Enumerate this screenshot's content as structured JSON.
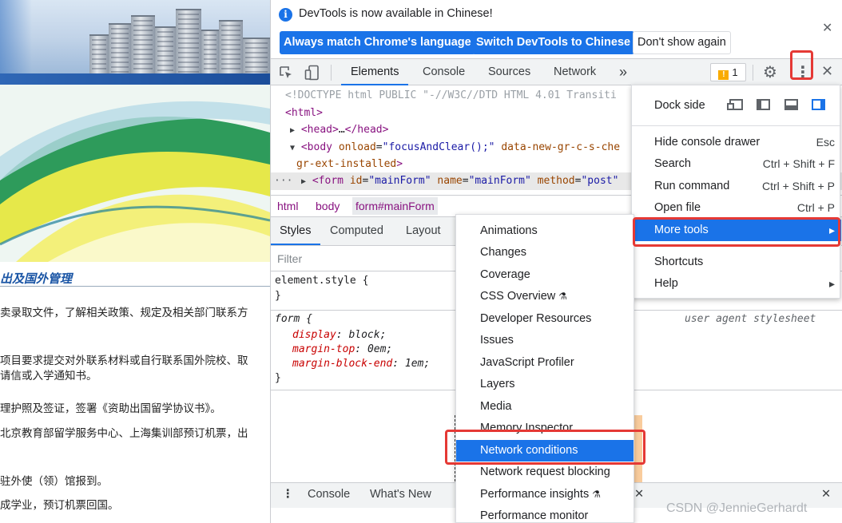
{
  "webpage": {
    "section_title": "出及国外管理",
    "paragraphs": [
      "卖录取文件，了解相关政策、规定及相关部门联系方",
      "项目要求提交对外联系材料或自行联系国外院校、取",
      "请信或入学通知书。",
      "理护照及签证，签署《资助出国留学协议书》。",
      "北京教育部留学服务中心、上海集训部预订机票，出",
      "驻外使（领）馆报到。",
      "成学业，预订机票回国。"
    ]
  },
  "infobar": {
    "message": "DevTools is now available in Chinese!",
    "info_icon": "info-icon",
    "buttons": {
      "match": "Always match Chrome's language",
      "switch": "Switch DevTools to Chinese",
      "dismiss": "Don't show again"
    },
    "close_glyph": "✕"
  },
  "toolbar": {
    "tabs": [
      "Elements",
      "Console",
      "Sources",
      "Network"
    ],
    "overflow_glyph": "»",
    "issues_count": "1",
    "settings_glyph": "⚙",
    "menu_glyph": "⋮",
    "close_glyph": "✕"
  },
  "dom": {
    "doctype": "<!DOCTYPE html PUBLIC \"-//W3C//DTD HTML 4.01 Transiti",
    "html_open": "<html>",
    "head_open": "<head>",
    "head_ellipsis": "…",
    "head_close": "</head>",
    "body_tag_open": "<body",
    "body_attr_onload": "onload",
    "body_attr_onload_value": "\"focusAndClear();\"",
    "body_attr_data": "data-new-gr-c-s-che",
    "body_line2": "gr-ext-installed",
    "body_tag_close": ">",
    "form_tag_open": "<form",
    "form_attr_id": "id",
    "form_attr_id_value": "\"mainForm\"",
    "form_attr_name": "name",
    "form_attr_name_value": "\"mainForm\"",
    "form_attr_method": "method",
    "form_attr_method_value": "\"post\"",
    "ellipsis_dots": "···"
  },
  "breadcrumbs": [
    "html",
    "body",
    "form#mainForm"
  ],
  "subtabs": [
    "Styles",
    "Computed",
    "Layout"
  ],
  "filter_placeholder": "Filter",
  "styles": {
    "element_style_selector": "element.style {",
    "close_brace": "}",
    "form_selector": "form {",
    "ua_label": "user agent stylesheet",
    "declarations": [
      {
        "name": "display",
        "value": "block;"
      },
      {
        "name": "margin-top",
        "value": "0em;"
      },
      {
        "name": "margin-block-end",
        "value": "1em;"
      }
    ]
  },
  "drawer": {
    "tabs": [
      "Console",
      "What's New"
    ],
    "menu_glyph": "⋮",
    "close_glyph": "✕"
  },
  "main_menu": {
    "dock_side_label": "Dock side",
    "items": [
      {
        "label": "Hide console drawer",
        "shortcut": "Esc"
      },
      {
        "label": "Search",
        "shortcut": "Ctrl + Shift + F"
      },
      {
        "label": "Run command",
        "shortcut": "Ctrl + Shift + P"
      },
      {
        "label": "Open file",
        "shortcut": "Ctrl + P"
      },
      {
        "label": "More tools",
        "shortcut": "▸"
      },
      {
        "label": "Shortcuts",
        "shortcut": ""
      },
      {
        "label": "Help",
        "shortcut": "▸"
      }
    ],
    "highlighted": "More tools"
  },
  "sub_menu": {
    "items": [
      {
        "label": "Animations"
      },
      {
        "label": "Changes"
      },
      {
        "label": "Coverage"
      },
      {
        "label": "CSS Overview",
        "experimental": "⚗"
      },
      {
        "label": "Developer Resources"
      },
      {
        "label": "Issues"
      },
      {
        "label": "JavaScript Profiler"
      },
      {
        "label": "Layers"
      },
      {
        "label": "Media"
      },
      {
        "label": "Memory Inspector"
      },
      {
        "label": "Network conditions"
      },
      {
        "label": "Network request blocking"
      },
      {
        "label": "Performance insights",
        "experimental": "⚗"
      },
      {
        "label": "Performance monitor"
      }
    ],
    "highlighted": "Network conditions"
  },
  "watermark": "CSDN @JennieGerhardt",
  "colors": {
    "accent": "#1a73e8",
    "annotation_red": "#e53935",
    "tag": "#881280"
  }
}
